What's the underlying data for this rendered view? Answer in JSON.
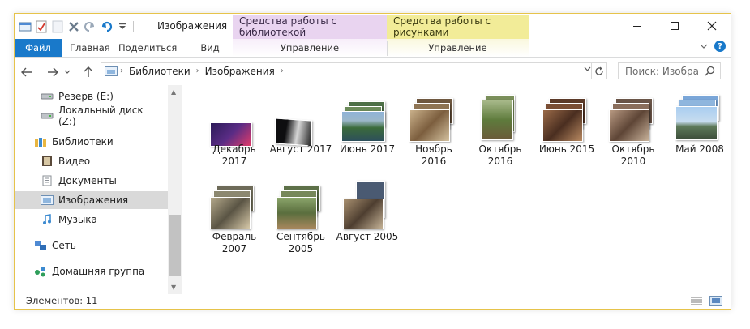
{
  "window": {
    "title": "Изображения",
    "context_tab_library": "Средства работы с библиотекой",
    "context_tab_pictures": "Средства работы с рисунками"
  },
  "ribbon": {
    "tabs": [
      "Файл",
      "Главная",
      "Поделиться",
      "Вид",
      "Управление",
      "Управление"
    ]
  },
  "address": {
    "crumbs": [
      "Библиотеки",
      "Изображения"
    ],
    "search_placeholder": "Поиск: Изобра..."
  },
  "nav": {
    "items": [
      {
        "label": "Резерв (E:)",
        "icon": "drive-icon"
      },
      {
        "label": "Локальный диск (Z:)",
        "icon": "drive-icon"
      },
      {
        "label": "Библиотеки",
        "icon": "libraries-icon"
      },
      {
        "label": "Видео",
        "icon": "video-library-icon"
      },
      {
        "label": "Документы",
        "icon": "documents-library-icon"
      },
      {
        "label": "Изображения",
        "icon": "pictures-library-icon"
      },
      {
        "label": "Музыка",
        "icon": "music-library-icon"
      },
      {
        "label": "Сеть",
        "icon": "network-icon"
      },
      {
        "label": "Домашняя группа",
        "icon": "homegroup-icon"
      }
    ],
    "selected": "Изображения"
  },
  "folders": [
    {
      "line1": "Декабрь",
      "line2": "2017"
    },
    {
      "line1": "Август 2017",
      "line2": ""
    },
    {
      "line1": "Июнь 2017",
      "line2": ""
    },
    {
      "line1": "Ноябрь",
      "line2": "2016"
    },
    {
      "line1": "Октябрь",
      "line2": "2016"
    },
    {
      "line1": "Июнь 2015",
      "line2": ""
    },
    {
      "line1": "Октябрь",
      "line2": "2010"
    },
    {
      "line1": "Май 2008",
      "line2": ""
    },
    {
      "line1": "Февраль",
      "line2": "2007"
    },
    {
      "line1": "Сентябрь",
      "line2": "2005"
    },
    {
      "line1": "Август 2005",
      "line2": ""
    }
  ],
  "status": {
    "count": "Элементов: 11"
  },
  "colors": {
    "file_tab": "#1979ca",
    "library_tools": "#e9d4f0",
    "picture_tools": "#f2ec98",
    "window_border": "#e6c34a"
  }
}
